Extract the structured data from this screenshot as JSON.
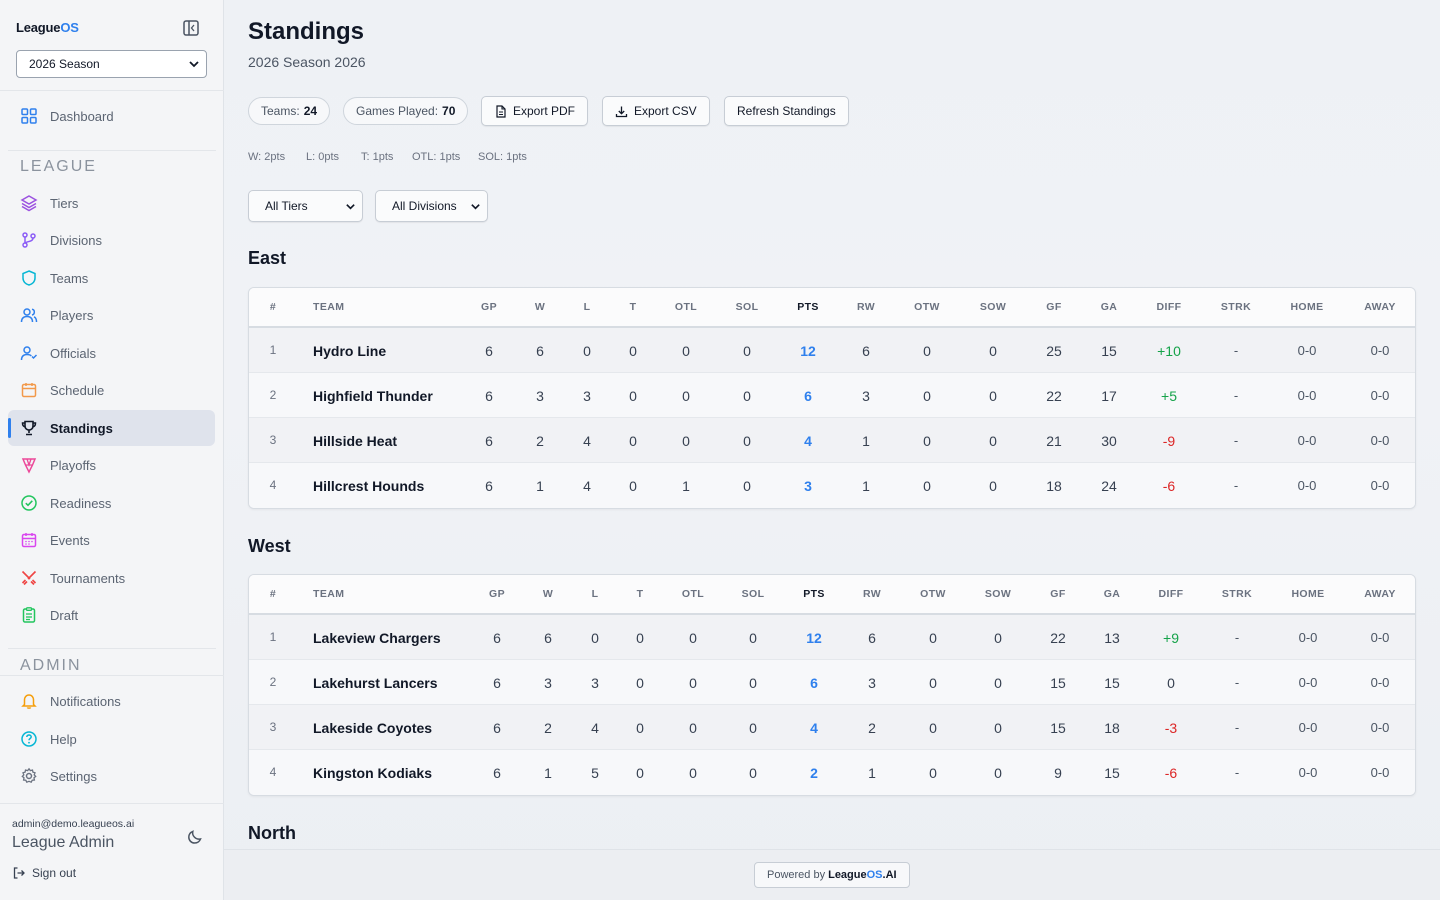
{
  "brand": {
    "name": "League",
    "suffix": "OS"
  },
  "season_select": {
    "value": "2026 Season"
  },
  "nav": {
    "dashboard": "Dashboard",
    "league_header": "LEAGUE",
    "league_items": [
      "Tiers",
      "Divisions",
      "Teams",
      "Players",
      "Officials",
      "Schedule",
      "Standings",
      "Playoffs",
      "Readiness",
      "Events",
      "Tournaments",
      "Draft"
    ],
    "admin_header": "ADMIN",
    "admin_items": [
      "Notifications",
      "Help",
      "Settings"
    ],
    "active": "Standings"
  },
  "user": {
    "email": "admin@demo.leagueos.ai",
    "name": "League Admin",
    "signout": "Sign out"
  },
  "page": {
    "title": "Standings",
    "subtitle": "2026 Season 2026"
  },
  "stats": {
    "teams_label": "Teams:",
    "teams_value": "24",
    "games_label": "Games Played:",
    "games_value": "70"
  },
  "buttons": {
    "export_pdf": "Export PDF",
    "export_csv": "Export CSV",
    "refresh": "Refresh Standings"
  },
  "rules": [
    "W: 2pts",
    "L: 0pts",
    "T: 1pts",
    "OTL: 1pts",
    "SOL: 1pts"
  ],
  "filters": {
    "tier": "All Tiers",
    "division": "All Divisions"
  },
  "columns": [
    "#",
    "TEAM",
    "GP",
    "W",
    "L",
    "T",
    "OTL",
    "SOL",
    "PTS",
    "RW",
    "OTW",
    "SOW",
    "GF",
    "GA",
    "DIFF",
    "STRK",
    "HOME",
    "AWAY"
  ],
  "divisions": [
    {
      "name": "East",
      "rows": [
        [
          "1",
          "Hydro Line",
          "6",
          "6",
          "0",
          "0",
          "0",
          "0",
          "12",
          "6",
          "0",
          "0",
          "25",
          "15",
          "+10",
          "-",
          "0-0",
          "0-0"
        ],
        [
          "2",
          "Highfield Thunder",
          "6",
          "3",
          "3",
          "0",
          "0",
          "0",
          "6",
          "3",
          "0",
          "0",
          "22",
          "17",
          "+5",
          "-",
          "0-0",
          "0-0"
        ],
        [
          "3",
          "Hillside Heat",
          "6",
          "2",
          "4",
          "0",
          "0",
          "0",
          "4",
          "1",
          "0",
          "0",
          "21",
          "30",
          "-9",
          "-",
          "0-0",
          "0-0"
        ],
        [
          "4",
          "Hillcrest Hounds",
          "6",
          "1",
          "4",
          "0",
          "1",
          "0",
          "3",
          "1",
          "0",
          "0",
          "18",
          "24",
          "-6",
          "-",
          "0-0",
          "0-0"
        ]
      ]
    },
    {
      "name": "West",
      "rows": [
        [
          "1",
          "Lakeview Chargers",
          "6",
          "6",
          "0",
          "0",
          "0",
          "0",
          "12",
          "6",
          "0",
          "0",
          "22",
          "13",
          "+9",
          "-",
          "0-0",
          "0-0"
        ],
        [
          "2",
          "Lakehurst Lancers",
          "6",
          "3",
          "3",
          "0",
          "0",
          "0",
          "6",
          "3",
          "0",
          "0",
          "15",
          "15",
          "0",
          "-",
          "0-0",
          "0-0"
        ],
        [
          "3",
          "Lakeside Coyotes",
          "6",
          "2",
          "4",
          "0",
          "0",
          "0",
          "4",
          "2",
          "0",
          "0",
          "15",
          "18",
          "-3",
          "-",
          "0-0",
          "0-0"
        ],
        [
          "4",
          "Kingston Kodiaks",
          "6",
          "1",
          "5",
          "0",
          "0",
          "0",
          "2",
          "1",
          "0",
          "0",
          "9",
          "15",
          "-6",
          "-",
          "0-0",
          "0-0"
        ]
      ]
    },
    {
      "name": "North",
      "rows": []
    }
  ],
  "footer": {
    "powered_by": "Powered by",
    "brand": "League",
    "brand_suffix": "OS",
    "brand_tld": ".AI"
  },
  "colors": {
    "accent": "#2f80ed",
    "positive": "#16a34a",
    "negative": "#dc2626"
  }
}
